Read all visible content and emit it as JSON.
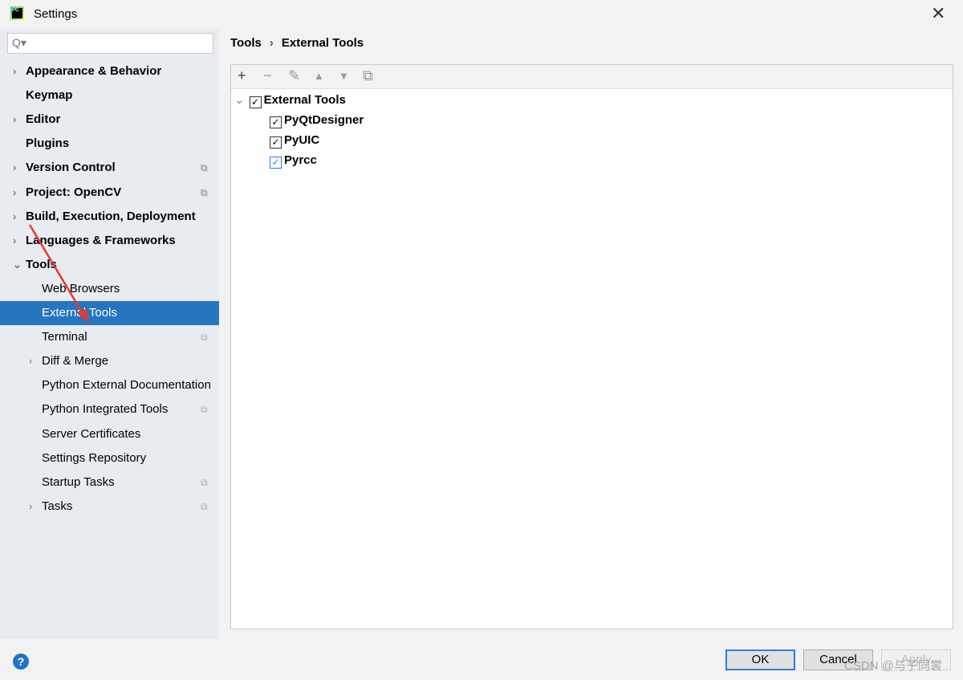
{
  "window": {
    "title": "Settings",
    "close_icon": "✕"
  },
  "search": {
    "placeholder": "",
    "icon": "Q▾"
  },
  "sidebar": {
    "items": [
      {
        "label": "Appearance & Behavior",
        "bold": true,
        "arrow": "›"
      },
      {
        "label": "Keymap",
        "bold": true
      },
      {
        "label": "Editor",
        "bold": true,
        "arrow": "›"
      },
      {
        "label": "Plugins",
        "bold": true
      },
      {
        "label": "Version Control",
        "bold": true,
        "arrow": "›",
        "copy": true
      },
      {
        "label": "Project: OpenCV",
        "bold": true,
        "arrow": "›",
        "copy": true
      },
      {
        "label": "Build, Execution, Deployment",
        "bold": true,
        "arrow": "›"
      },
      {
        "label": "Languages & Frameworks",
        "bold": true,
        "arrow": "›"
      },
      {
        "label": "Tools",
        "bold": true,
        "arrow": "⌄"
      },
      {
        "label": "Web Browsers",
        "indent": 1
      },
      {
        "label": "External Tools",
        "indent": 1,
        "selected": true
      },
      {
        "label": "Terminal",
        "indent": 1,
        "copy": true
      },
      {
        "label": "Diff & Merge",
        "indent": 1,
        "arrow": "›"
      },
      {
        "label": "Python External Documentation",
        "indent": 1
      },
      {
        "label": "Python Integrated Tools",
        "indent": 1,
        "copy": true
      },
      {
        "label": "Server Certificates",
        "indent": 1
      },
      {
        "label": "Settings Repository",
        "indent": 1
      },
      {
        "label": "Startup Tasks",
        "indent": 1,
        "copy": true
      },
      {
        "label": "Tasks",
        "indent": 1,
        "arrow": "›",
        "copy": true
      }
    ]
  },
  "breadcrumb": {
    "parent": "Tools",
    "sep": "›",
    "current": "External Tools"
  },
  "toolbar": {
    "add": "+",
    "remove": "−",
    "edit": "✎",
    "up": "▲",
    "down": "▼",
    "copy": "⧉"
  },
  "tree": {
    "root": {
      "label": "External Tools",
      "checked": true
    },
    "children": [
      {
        "label": "PyQtDesigner",
        "checked": true
      },
      {
        "label": "PyUIC",
        "checked": true
      },
      {
        "label": "Pyrcc",
        "checked": true
      }
    ]
  },
  "footer": {
    "help": "?",
    "ok": "OK",
    "cancel": "Cancel",
    "apply": "Apply"
  },
  "watermark": "CSDN @与子同裳",
  "colors": {
    "selection": "#2675bf",
    "arrow": "#e8382f"
  }
}
